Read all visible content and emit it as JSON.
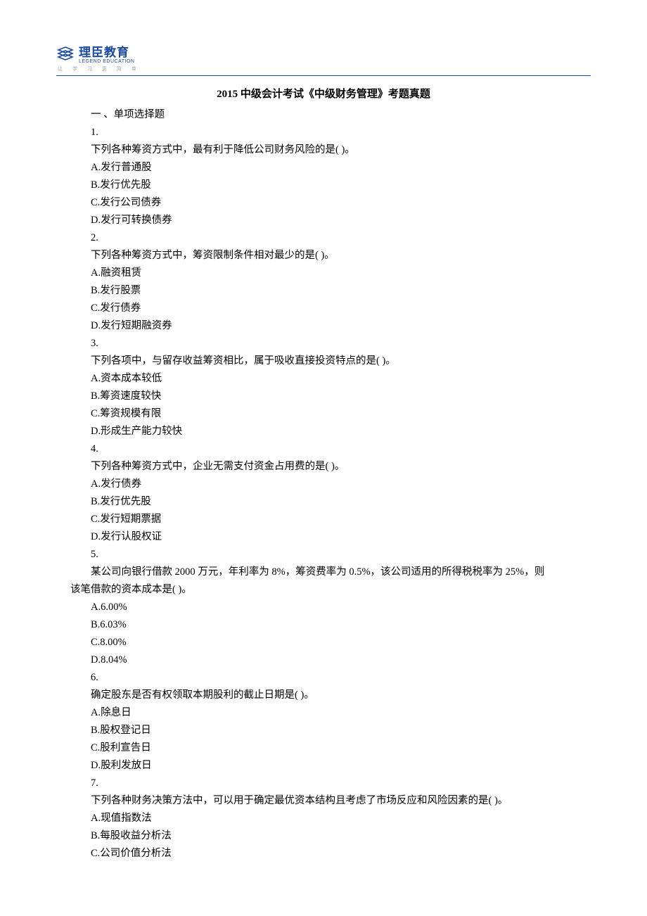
{
  "logo": {
    "name_cn": "理臣教育",
    "name_en": "LEGEND EDUCATION",
    "tagline": "让 学 习 更 简 单"
  },
  "title": "2015 中级会计考试《中级财务管理》考题真题",
  "section_heading": "一 、单项选择题",
  "questions": [
    {
      "num": "1.",
      "stem": "下列各种筹资方式中，最有利于降低公司财务风险的是( )。",
      "opts": [
        "A.发行普通股",
        "B.发行优先股",
        "C.发行公司债券",
        "D.发行可转换债券"
      ]
    },
    {
      "num": "2.",
      "stem": "下列各种筹资方式中，筹资限制条件相对最少的是( )。",
      "opts": [
        "A.融资租赁",
        "B.发行股票",
        "C.发行债券",
        "D.发行短期融资券"
      ]
    },
    {
      "num": "3.",
      "stem": "下列各项中，与留存收益筹资相比，属于吸收直接投资特点的是( )。",
      "opts": [
        "A.资本成本较低",
        "B.筹资速度较快",
        "C.筹资规模有限",
        "D.形成生产能力较快"
      ]
    },
    {
      "num": "4.",
      "stem": "下列各种筹资方式中，企业无需支付资金占用费的是( )。",
      "opts": [
        "A.发行债券",
        "B.发行优先股",
        "C.发行短期票据",
        "D.发行认股权证"
      ]
    },
    {
      "num": "5.",
      "stem_lines": [
        "某公司向银行借款 2000 万元，年利率为 8%，筹资费率为 0.5%，该公司适用的所得税税率为 25%，则",
        "该笔借款的资本成本是( )。"
      ],
      "opts": [
        "A.6.00%",
        "B.6.03%",
        "C.8.00%",
        "D.8.04%"
      ]
    },
    {
      "num": "6.",
      "stem": "确定股东是否有权领取本期股利的截止日期是( )。",
      "opts": [
        "A.除息日",
        "B.股权登记日",
        "C.股利宣告日",
        "D.股利发放日"
      ]
    },
    {
      "num": "7.",
      "stem": "下列各种财务决策方法中，可以用于确定最优资本结构且考虑了市场反应和风险因素的是( )。",
      "opts": [
        "A.现值指数法",
        "B.每股收益分析法",
        "C.公司价值分析法"
      ]
    }
  ]
}
